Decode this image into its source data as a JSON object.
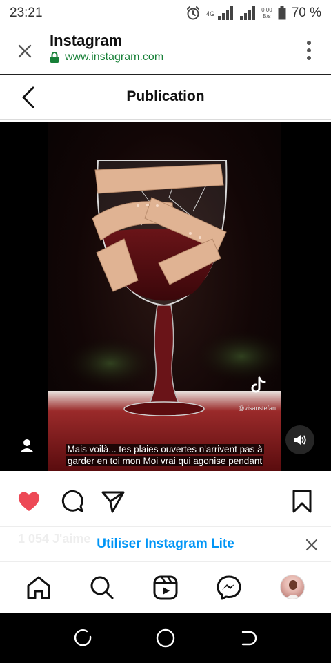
{
  "status_bar": {
    "time": "23:21",
    "network": "4G",
    "speed_value": "0.00",
    "speed_unit": "B/s",
    "battery": "70 %",
    "icons": [
      "alarm-icon",
      "signal-icon",
      "battery-icon"
    ]
  },
  "browser": {
    "title": "Instagram",
    "url": "www.instagram.com",
    "icons": [
      "close-icon",
      "lock-icon",
      "more-vertical-icon"
    ],
    "colors": {
      "url": "#188038",
      "lock": "#188038"
    }
  },
  "header": {
    "title": "Publication",
    "icons": [
      "back-arrow-icon"
    ]
  },
  "media": {
    "caption_line1": "Mais voilà... tes plaies ouvertes n'arrivent pas à",
    "caption_line2": "garder en toi mon Moi vrai qui agonise pendant",
    "watermark_handle": "@visanstefan",
    "icons": [
      "tiktok-icon",
      "user-tag-icon",
      "sound-on-icon"
    ]
  },
  "actions": {
    "liked": true,
    "icons": [
      "heart-filled-icon",
      "comment-icon",
      "share-icon",
      "bookmark-icon"
    ],
    "like_color": "#ed4956"
  },
  "likes_text": "1 054 J'aime",
  "lite_banner": {
    "label": "Utiliser Instagram Lite",
    "color": "#0095f6",
    "icons": [
      "close-icon"
    ]
  },
  "bottom_nav": {
    "icons": [
      "home-icon",
      "search-icon",
      "reels-icon",
      "messenger-icon",
      "profile-avatar"
    ]
  },
  "system_nav": {
    "icons": [
      "recents-icon",
      "home-circle-icon",
      "back-icon"
    ]
  }
}
